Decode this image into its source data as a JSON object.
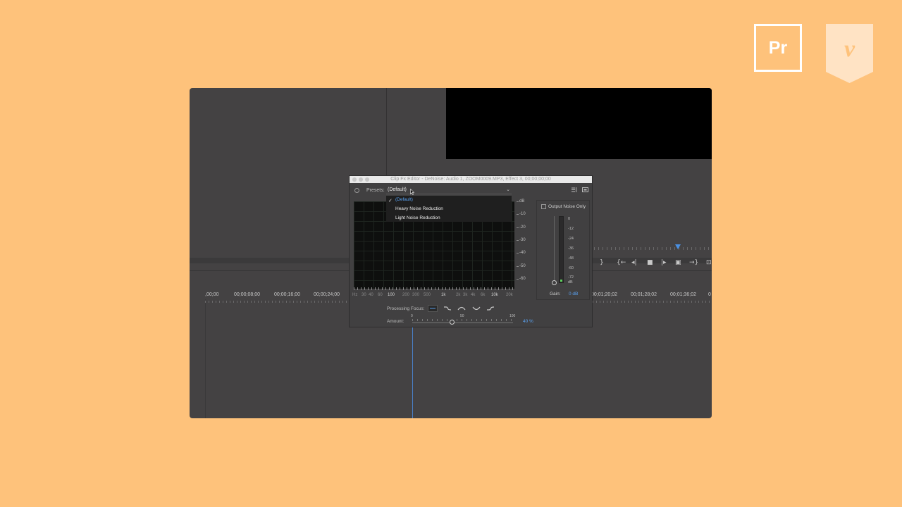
{
  "branding": {
    "premiere_logo_text": "Pr",
    "vimeo_logo_text": "v"
  },
  "timeline": {
    "timecodes": [
      {
        "label": ",00;00"
      },
      {
        "label": "00;00;08;00"
      },
      {
        "label": "00;00;16;00"
      },
      {
        "label": "00;00;24;00"
      },
      {
        "label": "00;01;20;02"
      },
      {
        "label": "00;01;28;02"
      },
      {
        "label": "00;01;36;02"
      },
      {
        "label": "0"
      }
    ],
    "transport_icons": [
      "out-point-icon",
      "go-to-in-icon",
      "step-back-icon",
      "stop-icon",
      "step-forward-icon",
      "safe-margins-icon",
      "go-to-out-icon",
      "lock-icon"
    ]
  },
  "dialog": {
    "title": "Clip Fx Editor - DeNoise: Audio 1, ZOOM0009.MP3, Effect 3, 00;00;00;00",
    "presets_label": "Presets:",
    "presets_value": "(Default)",
    "dropdown_items": [
      {
        "label": "(Default)",
        "selected": true
      },
      {
        "label": "Heavy Noise Reduction",
        "selected": false
      },
      {
        "label": "Light Noise Reduction",
        "selected": false
      }
    ],
    "db_scale": [
      "dB",
      "-10",
      "-20",
      "-30",
      "-40",
      "-50",
      "-60"
    ],
    "hz_axis": [
      "Hz",
      "30",
      "40",
      "60",
      "100",
      "200",
      "300",
      "500",
      "1k",
      "2k",
      "3k",
      "4k",
      "6k",
      "10k",
      "20k"
    ],
    "output_noise_only_label": "Output Noise Only",
    "output_noise_only_checked": false,
    "meter_scale": [
      "0",
      "-12",
      "-24",
      "-36",
      "-48",
      "-60",
      "-72",
      "dB"
    ],
    "gain_label": "Gain:",
    "gain_value": "0 dB",
    "processing_focus_label": "Processing Focus:",
    "processing_focus_options": [
      "flat-focus-icon",
      "low-focus-icon",
      "mid-focus-icon",
      "low-high-focus-icon",
      "high-focus-icon"
    ],
    "processing_focus_selected": 0,
    "amount_label": "Amount:",
    "amount_ticks": [
      "0",
      "50",
      "100"
    ],
    "amount_value": "40 %",
    "amount_fraction": 0.4
  },
  "colors": {
    "background": "#FEC27B",
    "panel": "#444243",
    "accent_blue": "#58a1f0"
  }
}
